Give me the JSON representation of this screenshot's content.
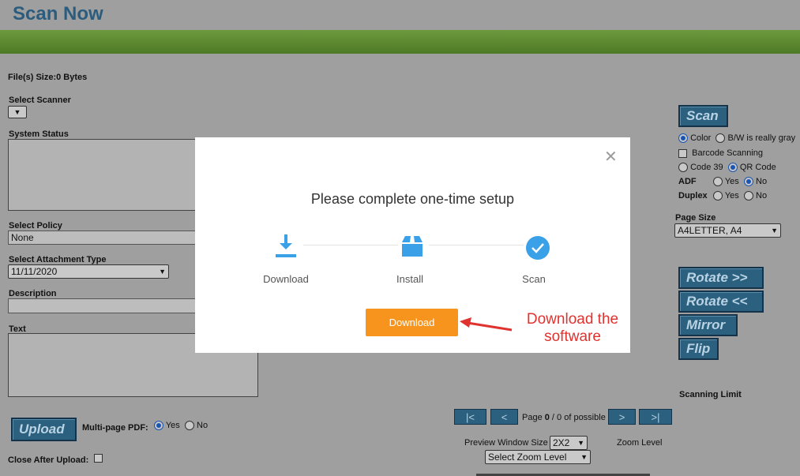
{
  "header": {
    "title": "Scan Now"
  },
  "left": {
    "file_size": "File(s) Size:0 Bytes",
    "select_scanner_label": "Select Scanner",
    "system_status_label": "System Status",
    "select_policy_label": "Select Policy",
    "policy_value": "None",
    "attachment_type_label": "Select Attachment Type",
    "attachment_value": "11/11/2020",
    "description_label": "Description",
    "text_label": "Text",
    "upload_label": "Upload",
    "multipage_label": "Multi-page PDF:",
    "yes": "Yes",
    "no": "No",
    "close_after_upload_label": "Close After Upload:"
  },
  "right": {
    "scan_label": "Scan",
    "color_label": "Color",
    "bw_label": "B/W is really gray",
    "barcode_label": "Barcode Scanning",
    "code39_label": "Code 39",
    "qr_label": "QR Code",
    "adf_label": "ADF",
    "duplex_label": "Duplex",
    "yes": "Yes",
    "no": "No",
    "page_size_label": "Page Size",
    "page_size_value": "A4LETTER, A4",
    "rotate_right": "Rotate >>",
    "rotate_left": "Rotate <<",
    "mirror": "Mirror",
    "flip": "Flip",
    "scanning_limit_label": "Scanning Limit"
  },
  "preview": {
    "first": "|<",
    "prev": "<",
    "page_prefix": "Page ",
    "page_current": "0",
    "page_suffix": " / 0 of possible",
    "next": ">",
    "last": ">|",
    "window_size_label": "Preview Window Size",
    "window_size_value": "2X2",
    "zoom_label": "Zoom Level",
    "zoom_select": "Select Zoom Level"
  },
  "modal": {
    "title": "Please complete one-time setup",
    "steps": [
      {
        "label": "Download",
        "icon": "download-icon"
      },
      {
        "label": "Install",
        "icon": "box-icon"
      },
      {
        "label": "Scan",
        "icon": "check-circle-icon"
      }
    ],
    "button": "Download",
    "close_icon": "close-icon"
  },
  "annotation": {
    "text": "Download the software"
  },
  "colors": {
    "accent_orange": "#f7941d",
    "icon_blue": "#3aa0e8",
    "annotation_red": "#e0322e",
    "header_blue": "#2b5c7e",
    "bar_green": "#5e8a30"
  }
}
